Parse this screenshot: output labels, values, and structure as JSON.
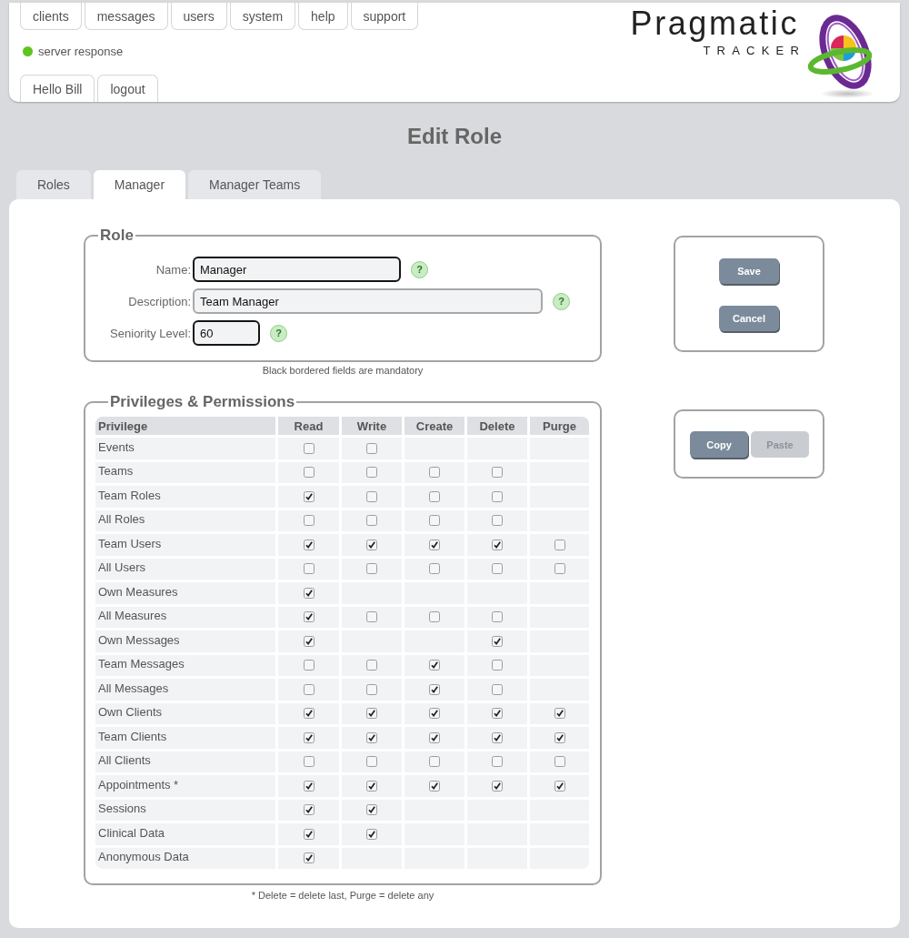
{
  "nav": [
    "clients",
    "messages",
    "users",
    "system",
    "help",
    "support"
  ],
  "status": {
    "label": "server response",
    "color": "#5ec41e"
  },
  "user_menu": [
    "Hello Bill",
    "logout"
  ],
  "logo": {
    "name": "Pragmatic",
    "subtitle": "TRACKER"
  },
  "title": "Edit Role",
  "tabs": [
    {
      "label": "Roles",
      "selected": false
    },
    {
      "label": "Manager",
      "selected": true
    },
    {
      "label": "Manager Teams",
      "selected": false
    }
  ],
  "role": {
    "legend": "Role",
    "fields": [
      {
        "label": "Name:",
        "value": "Manager",
        "mandatory": true,
        "help": "?"
      },
      {
        "label": "Description:",
        "value": "Team Manager",
        "mandatory": false,
        "help": "?"
      },
      {
        "label": "Seniority Level:",
        "value": "60",
        "mandatory": true,
        "help": "?"
      }
    ],
    "note": "Black bordered fields are mandatory"
  },
  "privileges": {
    "legend": "Privileges & Permissions",
    "columns": [
      "Privilege",
      "Read",
      "Write",
      "Create",
      "Delete",
      "Purge"
    ],
    "rows": [
      {
        "name": "Events",
        "cells": [
          {
            "kind": "checkbox",
            "checked": false
          },
          {
            "kind": "checkbox",
            "checked": false
          },
          {
            "kind": "empty"
          },
          {
            "kind": "empty"
          },
          {
            "kind": "empty"
          }
        ]
      },
      {
        "name": "Teams",
        "cells": [
          {
            "kind": "checkbox",
            "checked": false
          },
          {
            "kind": "checkbox",
            "checked": false
          },
          {
            "kind": "checkbox",
            "checked": false
          },
          {
            "kind": "checkbox",
            "checked": false
          },
          {
            "kind": "empty"
          }
        ]
      },
      {
        "name": "Team Roles",
        "cells": [
          {
            "kind": "checkbox",
            "checked": true
          },
          {
            "kind": "checkbox",
            "checked": false
          },
          {
            "kind": "checkbox",
            "checked": false
          },
          {
            "kind": "checkbox",
            "checked": false
          },
          {
            "kind": "empty"
          }
        ]
      },
      {
        "name": "All Roles",
        "cells": [
          {
            "kind": "checkbox",
            "checked": false
          },
          {
            "kind": "checkbox",
            "checked": false
          },
          {
            "kind": "checkbox",
            "checked": false
          },
          {
            "kind": "checkbox",
            "checked": false
          },
          {
            "kind": "empty"
          }
        ]
      },
      {
        "name": "Team Users",
        "cells": [
          {
            "kind": "checkbox",
            "checked": true
          },
          {
            "kind": "checkbox",
            "checked": true
          },
          {
            "kind": "checkbox",
            "checked": true
          },
          {
            "kind": "checkbox",
            "checked": true
          },
          {
            "kind": "checkbox",
            "checked": false
          }
        ]
      },
      {
        "name": "All Users",
        "cells": [
          {
            "kind": "checkbox",
            "checked": false
          },
          {
            "kind": "checkbox",
            "checked": false
          },
          {
            "kind": "checkbox",
            "checked": false
          },
          {
            "kind": "checkbox",
            "checked": false
          },
          {
            "kind": "checkbox",
            "checked": false
          }
        ]
      },
      {
        "name": "Own Measures",
        "cells": [
          {
            "kind": "checkbox",
            "checked": true
          },
          {
            "kind": "empty"
          },
          {
            "kind": "empty"
          },
          {
            "kind": "empty"
          },
          {
            "kind": "empty"
          }
        ]
      },
      {
        "name": "All Measures",
        "cells": [
          {
            "kind": "checkbox",
            "checked": true
          },
          {
            "kind": "checkbox",
            "checked": false
          },
          {
            "kind": "checkbox",
            "checked": false
          },
          {
            "kind": "checkbox",
            "checked": false
          },
          {
            "kind": "empty"
          }
        ]
      },
      {
        "name": "Own Messages",
        "cells": [
          {
            "kind": "checkbox",
            "checked": true
          },
          {
            "kind": "empty"
          },
          {
            "kind": "empty"
          },
          {
            "kind": "checkbox",
            "checked": true
          },
          {
            "kind": "empty"
          }
        ]
      },
      {
        "name": "Team Messages",
        "cells": [
          {
            "kind": "checkbox",
            "checked": false
          },
          {
            "kind": "checkbox",
            "checked": false
          },
          {
            "kind": "checkbox",
            "checked": true
          },
          {
            "kind": "checkbox",
            "checked": false
          },
          {
            "kind": "empty"
          }
        ]
      },
      {
        "name": "All Messages",
        "cells": [
          {
            "kind": "checkbox",
            "checked": false
          },
          {
            "kind": "checkbox",
            "checked": false
          },
          {
            "kind": "checkbox",
            "checked": true
          },
          {
            "kind": "checkbox",
            "checked": false
          },
          {
            "kind": "empty"
          }
        ]
      },
      {
        "name": "Own Clients",
        "cells": [
          {
            "kind": "checkbox",
            "checked": true
          },
          {
            "kind": "checkbox",
            "checked": true
          },
          {
            "kind": "checkbox",
            "checked": true
          },
          {
            "kind": "checkbox",
            "checked": true
          },
          {
            "kind": "checkbox",
            "checked": true
          }
        ]
      },
      {
        "name": "Team Clients",
        "cells": [
          {
            "kind": "checkbox",
            "checked": true
          },
          {
            "kind": "checkbox",
            "checked": true
          },
          {
            "kind": "checkbox",
            "checked": true
          },
          {
            "kind": "checkbox",
            "checked": true
          },
          {
            "kind": "checkbox",
            "checked": true
          }
        ]
      },
      {
        "name": "All Clients",
        "cells": [
          {
            "kind": "checkbox",
            "checked": false
          },
          {
            "kind": "checkbox",
            "checked": false
          },
          {
            "kind": "checkbox",
            "checked": false
          },
          {
            "kind": "checkbox",
            "checked": false
          },
          {
            "kind": "checkbox",
            "checked": false
          }
        ]
      },
      {
        "name": "Appointments *",
        "cells": [
          {
            "kind": "checkbox",
            "checked": true
          },
          {
            "kind": "checkbox",
            "checked": true
          },
          {
            "kind": "checkbox",
            "checked": true
          },
          {
            "kind": "checkbox",
            "checked": true
          },
          {
            "kind": "checkbox",
            "checked": true
          }
        ]
      },
      {
        "name": "Sessions",
        "cells": [
          {
            "kind": "checkbox",
            "checked": true
          },
          {
            "kind": "checkbox",
            "checked": true
          },
          {
            "kind": "empty"
          },
          {
            "kind": "empty"
          },
          {
            "kind": "empty"
          }
        ]
      },
      {
        "name": "Clinical Data",
        "cells": [
          {
            "kind": "checkbox",
            "checked": true
          },
          {
            "kind": "checkbox",
            "checked": true
          },
          {
            "kind": "empty"
          },
          {
            "kind": "empty"
          },
          {
            "kind": "empty"
          }
        ]
      },
      {
        "name": "Anonymous Data",
        "cells": [
          {
            "kind": "checkbox",
            "checked": true
          },
          {
            "kind": "empty"
          },
          {
            "kind": "empty"
          },
          {
            "kind": "empty"
          },
          {
            "kind": "empty"
          }
        ]
      }
    ],
    "note": "* Delete = delete last, Purge = delete any"
  },
  "actions": [
    {
      "label": "Save",
      "disabled": false
    },
    {
      "label": "Cancel",
      "disabled": false
    }
  ],
  "clipboard": [
    {
      "label": "Copy",
      "disabled": false
    },
    {
      "label": "Paste",
      "disabled": true
    }
  ]
}
